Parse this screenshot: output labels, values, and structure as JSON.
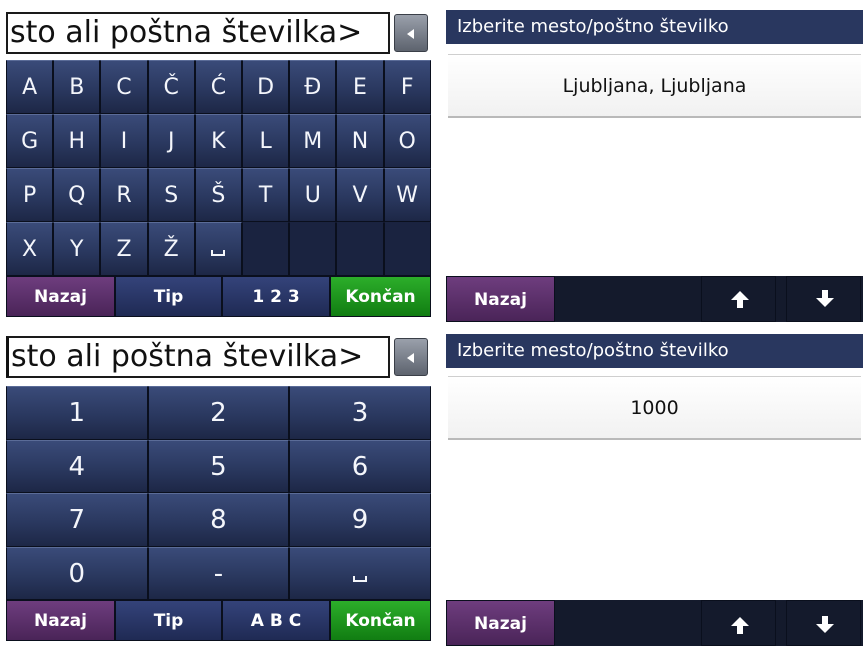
{
  "top": {
    "input_text": "sto ali poštna številka>",
    "keys_rows": [
      [
        "A",
        "B",
        "C",
        "Č",
        "Ć",
        "D",
        "Đ",
        "E",
        "F"
      ],
      [
        "G",
        "H",
        "I",
        "J",
        "K",
        "L",
        "M",
        "N",
        "O"
      ],
      [
        "P",
        "Q",
        "R",
        "S",
        "Š",
        "T",
        "U",
        "V",
        "W"
      ],
      [
        "X",
        "Y",
        "Z",
        "Ž",
        "space",
        "",
        "",
        "",
        ""
      ]
    ],
    "buttons": {
      "back": "Nazaj",
      "type": "Tip",
      "mode": "1 2 3",
      "done": "Končan"
    },
    "results": {
      "title": "Izberite mesto/poštno številko",
      "items": [
        "Ljubljana, Ljubljana"
      ],
      "back": "Nazaj"
    }
  },
  "bottom": {
    "input_text": "sto ali poštna številka>",
    "keys_rows": [
      [
        "1",
        "2",
        "3"
      ],
      [
        "4",
        "5",
        "6"
      ],
      [
        "7",
        "8",
        "9"
      ],
      [
        "0",
        "-",
        "space"
      ]
    ],
    "buttons": {
      "back": "Nazaj",
      "type": "Tip",
      "mode": "A B C",
      "done": "Končan"
    },
    "results": {
      "title": "Izberite mesto/poštno številko",
      "items": [
        "1000"
      ],
      "back": "Nazaj"
    }
  },
  "icons": {
    "backspace": "backspace-arrow-icon",
    "space": "space-bar-icon",
    "up": "up-arrow-icon",
    "down": "down-arrow-icon"
  },
  "colors": {
    "key_navy": "#2a385f",
    "title_bar": "#29375f",
    "back_purple": "#5a2d6a",
    "done_green": "#1f9b1e"
  }
}
